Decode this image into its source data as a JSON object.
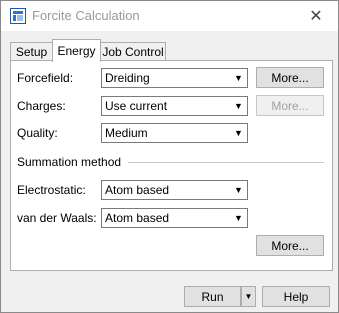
{
  "window": {
    "title": "Forcite Calculation",
    "close_glyph": "✕"
  },
  "tabs": [
    {
      "label": "Setup"
    },
    {
      "label": "Energy"
    },
    {
      "label": "Job Control"
    }
  ],
  "active_tab": "Energy",
  "fields": {
    "forcefield": {
      "label": "Forcefield:",
      "value": "Dreiding",
      "button": "More..."
    },
    "charges": {
      "label": "Charges:",
      "value": "Use current",
      "button": "More..."
    },
    "quality": {
      "label": "Quality:",
      "value": "Medium"
    }
  },
  "summation": {
    "heading": "Summation method",
    "electrostatic": {
      "label": "Electrostatic:",
      "value": "Atom based"
    },
    "vdw": {
      "label": "van der Waals:",
      "value": "Atom based"
    },
    "more_button": "More..."
  },
  "footer": {
    "run_label": "Run",
    "help_label": "Help"
  },
  "icons": {
    "app": "app-icon",
    "close": "close-icon",
    "dropdown": "chevron-down-icon"
  }
}
